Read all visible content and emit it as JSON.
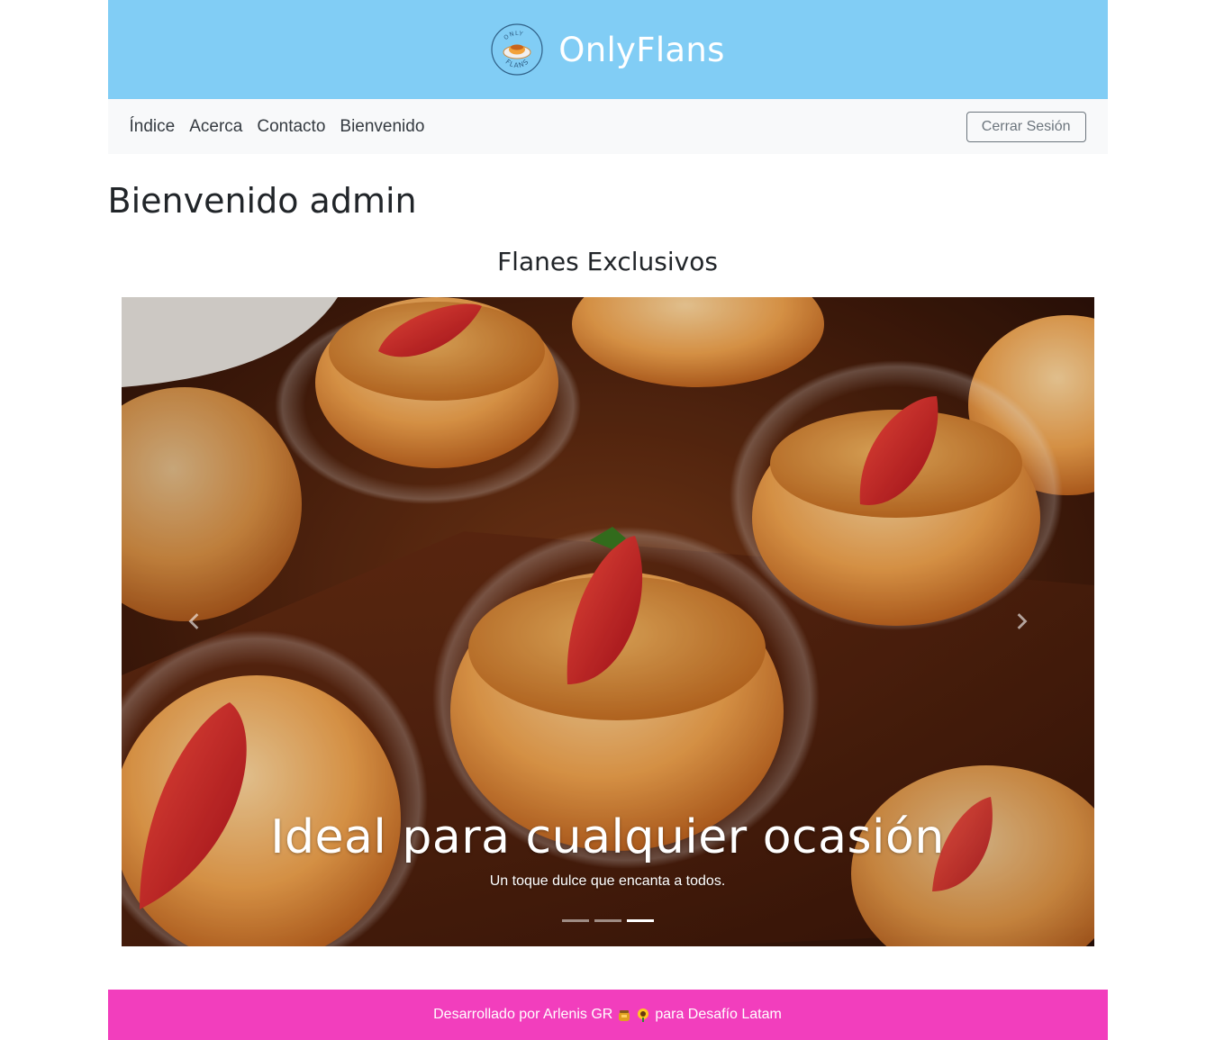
{
  "header": {
    "brand_name": "OnlyFlans",
    "logo_text_top": "ONLY",
    "logo_text_bottom": "FLANS",
    "bg_color": "#81cdf5"
  },
  "nav": {
    "links": [
      {
        "label": "Índice"
      },
      {
        "label": "Acerca"
      },
      {
        "label": "Contacto"
      },
      {
        "label": "Bienvenido"
      }
    ],
    "logout_label": "Cerrar Sesión"
  },
  "page": {
    "welcome": "Bienvenido admin",
    "section_title": "Flanes Exclusivos"
  },
  "carousel": {
    "caption_title": "Ideal para cualquier ocasión",
    "caption_text": "Un toque dulce que encanta a todos.",
    "slide_count": 3,
    "active_slide": 3,
    "prev_icon": "chevron-left-icon",
    "next_icon": "chevron-right-icon"
  },
  "footer": {
    "text_before": "Desarrollado por Arlenis GR",
    "text_after": "para Desafío Latam",
    "icons": [
      "honey-pot-icon",
      "sunflower-icon"
    ],
    "bg_color": "#f23ebd"
  }
}
